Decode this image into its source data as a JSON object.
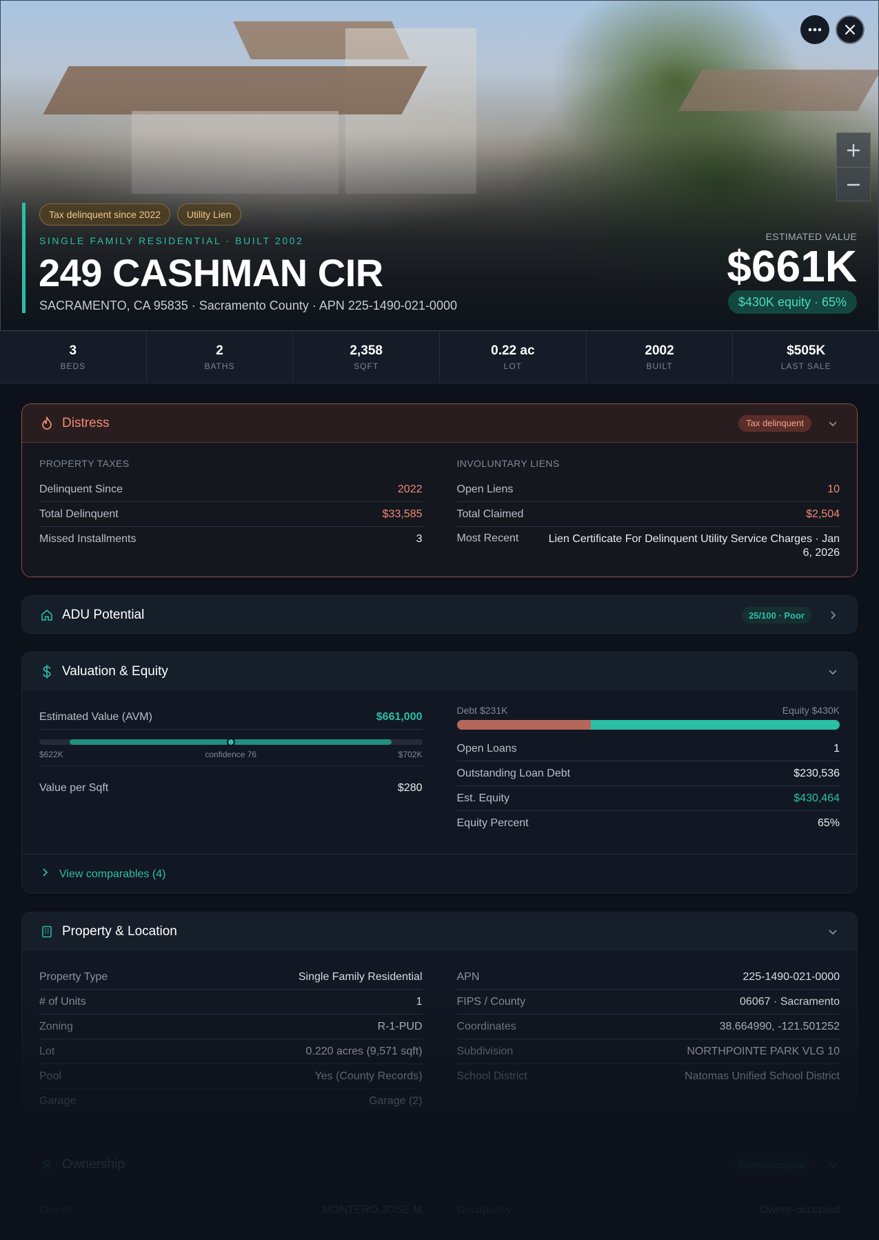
{
  "hero": {
    "badges": [
      "Tax delinquent since 2022",
      "Utility Lien"
    ],
    "subtitle": "SINGLE FAMILY RESIDENTIAL · BUILT 2002",
    "address": "249 CASHMAN CIR",
    "location": "SACRAMENTO, CA 95835 · Sacramento County · APN 225-1490-021-0000",
    "estimated_label": "ESTIMATED VALUE",
    "estimated_value": "$661K",
    "equity_pill": "$430K equity · 65%"
  },
  "stats": [
    {
      "value": "3",
      "label": "BEDS"
    },
    {
      "value": "2",
      "label": "BATHS"
    },
    {
      "value": "2,358",
      "label": "SQFT"
    },
    {
      "value": "0.22 ac",
      "label": "LOT"
    },
    {
      "value": "2002",
      "label": "BUILT"
    },
    {
      "value": "$505K",
      "label": "LAST SALE"
    }
  ],
  "distress": {
    "title": "Distress",
    "tag": "Tax delinquent",
    "taxes": {
      "label": "PROPERTY TAXES",
      "rows": [
        {
          "k": "Delinquent Since",
          "v": "2022"
        },
        {
          "k": "Total Delinquent",
          "v": "$33,585"
        },
        {
          "k": "Missed Installments",
          "v": "3"
        }
      ]
    },
    "liens": {
      "label": "INVOLUNTARY LIENS",
      "rows": [
        {
          "k": "Open Liens",
          "v": "10"
        },
        {
          "k": "Total Claimed",
          "v": "$2,504"
        },
        {
          "k": "Most Recent",
          "v": "Lien Certificate For Delinquent Utility Service Charges · Jan 6, 2026"
        }
      ]
    }
  },
  "adu": {
    "title": "ADU Potential",
    "tag": "25/100 · Poor"
  },
  "valuation": {
    "title": "Valuation & Equity",
    "avm_label": "Estimated Value (AVM)",
    "avm_value": "$661,000",
    "range_low": "$622K",
    "range_high": "$702K",
    "confidence": "confidence 76",
    "range_fill_start": 0.08,
    "range_fill_end": 0.92,
    "range_marker": 0.5,
    "vps_label": "Value per Sqft",
    "vps_value": "$280",
    "debt_label": "Debt $231K",
    "equity_label": "Equity $430K",
    "debt_fraction": 0.35,
    "rows": [
      {
        "k": "Open Loans",
        "v": "1"
      },
      {
        "k": "Outstanding Loan Debt",
        "v": "$230,536"
      },
      {
        "k": "Est. Equity",
        "v": "$430,464"
      },
      {
        "k": "Equity Percent",
        "v": "65%"
      }
    ],
    "comparables": "View comparables (4)"
  },
  "property": {
    "title": "Property & Location",
    "left": [
      {
        "k": "Property Type",
        "v": "Single Family Residential"
      },
      {
        "k": "# of Units",
        "v": "1"
      },
      {
        "k": "Zoning",
        "v": "R-1-PUD"
      },
      {
        "k": "Lot",
        "v": "0.220 acres (9,571 sqft)"
      },
      {
        "k": "Pool",
        "v": "Yes (County Records)"
      },
      {
        "k": "Garage",
        "v": "Garage (2)"
      }
    ],
    "right": [
      {
        "k": "APN",
        "v": "225-1490-021-0000"
      },
      {
        "k": "FIPS / County",
        "v": "06067 · Sacramento"
      },
      {
        "k": "Coordinates",
        "v": "38.664990, -121.501252"
      },
      {
        "k": "Subdivision",
        "v": "NORTHPOINTE PARK VLG 10"
      },
      {
        "k": "School District",
        "v": "Natomas Unified School District"
      }
    ]
  },
  "ownership": {
    "title": "Ownership",
    "tag": "Owner-occupied",
    "rows_left": [
      {
        "k": "Owner",
        "v": "MONTERO JOSE M"
      }
    ],
    "rows_right": [
      {
        "k": "Occupancy",
        "v": "Owner-occupied"
      }
    ]
  },
  "colors": {
    "accent": "#2bbfa6",
    "danger": "#f08a72",
    "badge": "#f0c98a",
    "background": "#0c111a"
  }
}
